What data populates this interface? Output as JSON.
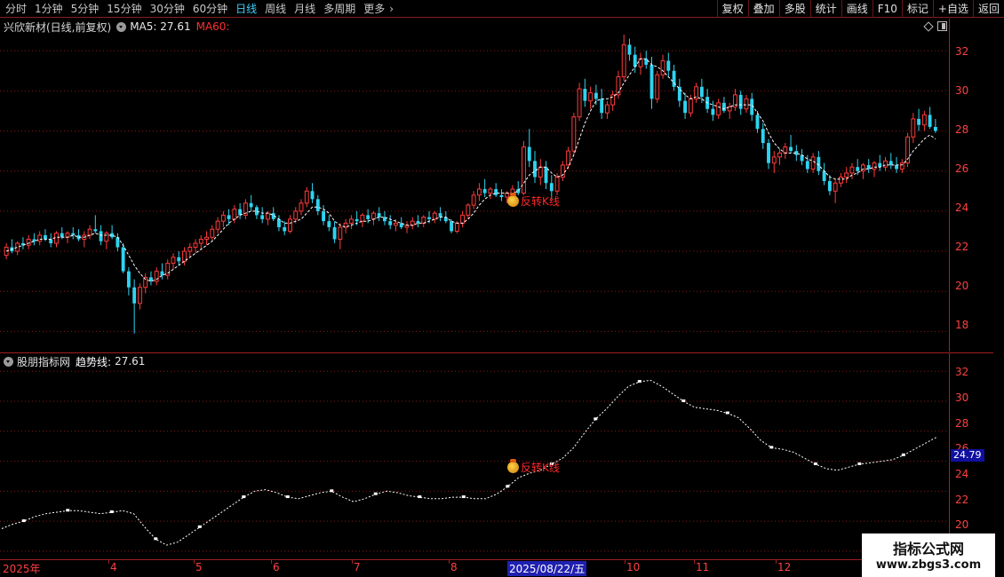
{
  "toolbar": {
    "periods": [
      "分时",
      "1分钟",
      "5分钟",
      "15分钟",
      "30分钟",
      "60分钟",
      "日线",
      "周线",
      "月线",
      "多周期",
      "更多"
    ],
    "active_period": "日线",
    "tools": [
      "复权",
      "叠加",
      "多股",
      "统计",
      "画线",
      "F10",
      "标记",
      "+自选",
      "返回"
    ]
  },
  "main_panel": {
    "stock_name": "兴欣新材(日线,前复权)",
    "ma5_label": "MA5: 27.61",
    "ma60_label": "MA60:",
    "annotation": "反转K线"
  },
  "indicator_panel": {
    "name": "股朋指标网",
    "line_label": "趋势线:",
    "line_value": "27.61",
    "current_value": "24.79",
    "annotation": "反转K线"
  },
  "date_axis": {
    "labels": [
      "2025年",
      "4",
      "5",
      "6",
      "7",
      "8",
      "10",
      "11",
      "12"
    ],
    "selected_date": "2025/08/22/五"
  },
  "watermark": {
    "title": "指标公式网",
    "url": "www.zbgs3.com"
  },
  "colors": {
    "up": "#ff3b3b",
    "down": "#2ed3f0",
    "grid": "#8a1a1a",
    "axis": "#ff4040",
    "trend": "#ffffff"
  },
  "chart_data": [
    {
      "type": "candlestick",
      "yticks": [
        18,
        20,
        22,
        24,
        26,
        28,
        30,
        32
      ],
      "ylim": [
        17.0,
        33.6
      ],
      "candles_ohlc": [
        [
          21.8,
          22.4,
          21.6,
          22.2
        ],
        [
          22.2,
          22.6,
          21.9,
          22.0
        ],
        [
          22.0,
          22.5,
          21.8,
          22.4
        ],
        [
          22.4,
          22.7,
          22.1,
          22.3
        ],
        [
          22.3,
          22.8,
          22.1,
          22.6
        ],
        [
          22.6,
          22.9,
          22.3,
          22.5
        ],
        [
          22.5,
          23.0,
          22.3,
          22.8
        ],
        [
          22.8,
          23.1,
          22.5,
          22.6
        ],
        [
          22.6,
          22.9,
          22.2,
          22.4
        ],
        [
          22.4,
          23.0,
          22.2,
          22.9
        ],
        [
          22.9,
          23.2,
          22.6,
          22.7
        ],
        [
          22.7,
          23.0,
          22.4,
          22.9
        ],
        [
          22.9,
          23.2,
          22.6,
          22.8
        ],
        [
          22.8,
          23.1,
          22.5,
          22.6
        ],
        [
          22.6,
          23.0,
          22.2,
          22.8
        ],
        [
          22.8,
          23.3,
          22.6,
          23.1
        ],
        [
          23.1,
          23.8,
          22.9,
          23.0
        ],
        [
          23.0,
          23.3,
          22.3,
          22.5
        ],
        [
          22.5,
          23.0,
          22.1,
          22.9
        ],
        [
          22.9,
          23.3,
          22.6,
          22.7
        ],
        [
          22.7,
          22.9,
          22.0,
          22.2
        ],
        [
          22.2,
          22.4,
          20.9,
          21.0
        ],
        [
          21.0,
          21.2,
          19.8,
          20.2
        ],
        [
          20.2,
          20.6,
          17.9,
          19.4
        ],
        [
          19.4,
          20.4,
          19.1,
          20.2
        ],
        [
          20.2,
          20.9,
          19.9,
          20.7
        ],
        [
          20.7,
          21.0,
          20.3,
          20.5
        ],
        [
          20.5,
          21.2,
          20.3,
          21.0
        ],
        [
          21.0,
          21.4,
          20.6,
          20.8
        ],
        [
          20.8,
          21.6,
          20.6,
          21.4
        ],
        [
          21.4,
          21.9,
          21.1,
          21.7
        ],
        [
          21.7,
          22.0,
          21.3,
          21.5
        ],
        [
          21.5,
          22.2,
          21.3,
          22.0
        ],
        [
          22.0,
          22.4,
          21.7,
          22.2
        ],
        [
          22.2,
          22.6,
          21.9,
          22.4
        ],
        [
          22.4,
          22.8,
          22.1,
          22.6
        ],
        [
          22.6,
          23.0,
          22.3,
          22.7
        ],
        [
          22.7,
          23.3,
          22.5,
          23.1
        ],
        [
          23.1,
          23.7,
          22.9,
          23.5
        ],
        [
          23.5,
          24.0,
          23.2,
          23.8
        ],
        [
          23.8,
          24.1,
          23.3,
          23.6
        ],
        [
          23.6,
          24.3,
          23.4,
          24.1
        ],
        [
          24.1,
          24.4,
          23.6,
          23.8
        ],
        [
          23.8,
          24.6,
          23.6,
          24.4
        ],
        [
          24.4,
          24.8,
          24.0,
          24.2
        ],
        [
          24.2,
          24.3,
          23.6,
          23.8
        ],
        [
          23.8,
          24.2,
          23.4,
          23.6
        ],
        [
          23.6,
          24.0,
          23.3,
          23.9
        ],
        [
          23.9,
          24.2,
          23.5,
          23.6
        ],
        [
          23.6,
          23.8,
          23.0,
          23.2
        ],
        [
          23.2,
          23.5,
          22.8,
          23.0
        ],
        [
          23.0,
          23.8,
          22.9,
          23.6
        ],
        [
          23.6,
          24.2,
          23.4,
          24.0
        ],
        [
          24.0,
          24.6,
          23.8,
          24.4
        ],
        [
          24.4,
          25.2,
          24.2,
          25.0
        ],
        [
          25.0,
          25.4,
          24.4,
          24.6
        ],
        [
          24.6,
          24.8,
          23.8,
          24.0
        ],
        [
          24.0,
          24.3,
          23.3,
          23.5
        ],
        [
          23.5,
          23.8,
          23.0,
          23.2
        ],
        [
          23.2,
          23.5,
          22.4,
          22.6
        ],
        [
          22.6,
          23.4,
          22.1,
          23.2
        ],
        [
          23.2,
          23.6,
          22.9,
          23.4
        ],
        [
          23.4,
          23.8,
          23.1,
          23.6
        ],
        [
          23.6,
          24.0,
          23.3,
          23.5
        ],
        [
          23.5,
          23.9,
          23.2,
          23.8
        ],
        [
          23.8,
          24.1,
          23.4,
          23.6
        ],
        [
          23.6,
          24.0,
          23.3,
          23.9
        ],
        [
          23.9,
          24.2,
          23.5,
          23.7
        ],
        [
          23.7,
          24.0,
          23.3,
          23.5
        ],
        [
          23.5,
          23.8,
          23.1,
          23.3
        ],
        [
          23.3,
          23.6,
          23.0,
          23.4
        ],
        [
          23.4,
          23.7,
          23.1,
          23.2
        ],
        [
          23.2,
          23.5,
          22.9,
          23.3
        ],
        [
          23.3,
          23.7,
          23.1,
          23.5
        ],
        [
          23.5,
          23.8,
          23.2,
          23.4
        ],
        [
          23.4,
          23.8,
          23.2,
          23.7
        ],
        [
          23.7,
          24.0,
          23.4,
          23.6
        ],
        [
          23.6,
          24.0,
          23.4,
          23.9
        ],
        [
          23.9,
          24.2,
          23.5,
          23.7
        ],
        [
          23.7,
          24.0,
          23.4,
          23.5
        ],
        [
          23.5,
          23.6,
          22.9,
          23.0
        ],
        [
          23.0,
          23.5,
          22.9,
          23.4
        ],
        [
          23.4,
          24.0,
          23.2,
          23.8
        ],
        [
          23.8,
          24.4,
          23.6,
          24.3
        ],
        [
          24.3,
          25.0,
          24.1,
          24.8
        ],
        [
          24.8,
          25.4,
          24.5,
          25.1
        ],
        [
          25.1,
          25.6,
          24.7,
          24.9
        ],
        [
          24.9,
          25.2,
          24.6,
          25.1
        ],
        [
          25.1,
          25.4,
          24.7,
          24.8
        ],
        [
          24.8,
          25.1,
          24.5,
          24.7
        ],
        [
          24.7,
          25.0,
          24.4,
          24.9
        ],
        [
          24.9,
          25.3,
          24.6,
          25.1
        ],
        [
          25.1,
          25.5,
          24.8,
          24.9
        ],
        [
          24.9,
          27.5,
          24.8,
          27.2
        ],
        [
          27.2,
          28.1,
          26.2,
          26.5
        ],
        [
          26.5,
          27.0,
          25.4,
          25.7
        ],
        [
          25.7,
          26.6,
          25.3,
          26.2
        ],
        [
          26.2,
          26.5,
          25.1,
          25.4
        ],
        [
          25.4,
          25.8,
          24.6,
          25.0
        ],
        [
          25.0,
          25.9,
          24.8,
          25.7
        ],
        [
          25.7,
          26.5,
          25.5,
          26.3
        ],
        [
          26.3,
          27.2,
          26.1,
          27.0
        ],
        [
          27.0,
          28.9,
          26.8,
          28.7
        ],
        [
          28.7,
          30.4,
          28.5,
          30.1
        ],
        [
          30.1,
          30.6,
          29.2,
          29.5
        ],
        [
          29.5,
          30.2,
          29.1,
          29.9
        ],
        [
          29.9,
          30.3,
          29.3,
          29.6
        ],
        [
          29.6,
          30.1,
          28.6,
          28.9
        ],
        [
          28.9,
          29.5,
          28.6,
          29.3
        ],
        [
          29.3,
          30.0,
          29.0,
          29.8
        ],
        [
          29.8,
          31.0,
          29.6,
          30.7
        ],
        [
          30.7,
          32.8,
          30.5,
          32.3
        ],
        [
          32.3,
          32.6,
          31.5,
          31.8
        ],
        [
          31.8,
          32.2,
          30.9,
          31.2
        ],
        [
          31.2,
          31.9,
          30.8,
          31.6
        ],
        [
          31.6,
          32.0,
          31.1,
          31.3
        ],
        [
          31.3,
          31.7,
          29.1,
          29.6
        ],
        [
          29.6,
          31.0,
          29.4,
          30.8
        ],
        [
          30.8,
          31.8,
          30.6,
          31.5
        ],
        [
          31.5,
          31.9,
          30.7,
          31.0
        ],
        [
          31.0,
          31.3,
          30.0,
          30.2
        ],
        [
          30.2,
          30.6,
          29.2,
          29.5
        ],
        [
          29.5,
          29.9,
          28.6,
          28.9
        ],
        [
          28.9,
          29.8,
          28.7,
          29.6
        ],
        [
          29.6,
          30.4,
          29.4,
          30.2
        ],
        [
          30.2,
          30.6,
          29.4,
          29.7
        ],
        [
          29.7,
          30.1,
          28.9,
          29.1
        ],
        [
          29.1,
          29.5,
          28.5,
          28.8
        ],
        [
          28.8,
          29.6,
          28.6,
          29.4
        ],
        [
          29.4,
          29.7,
          28.9,
          29.0
        ],
        [
          29.0,
          29.4,
          28.6,
          29.2
        ],
        [
          29.2,
          30.1,
          29.0,
          29.8
        ],
        [
          29.8,
          30.0,
          28.8,
          29.1
        ],
        [
          29.1,
          29.8,
          28.9,
          29.6
        ],
        [
          29.6,
          29.9,
          28.5,
          28.8
        ],
        [
          28.8,
          29.0,
          27.9,
          28.1
        ],
        [
          28.1,
          28.4,
          27.1,
          27.4
        ],
        [
          27.4,
          27.6,
          26.1,
          26.4
        ],
        [
          26.4,
          27.0,
          25.9,
          26.7
        ],
        [
          26.7,
          27.1,
          26.3,
          26.9
        ],
        [
          26.9,
          27.4,
          26.6,
          27.2
        ],
        [
          27.2,
          27.8,
          26.9,
          27.0
        ],
        [
          27.0,
          27.3,
          26.5,
          26.8
        ],
        [
          26.8,
          27.1,
          26.3,
          26.5
        ],
        [
          26.5,
          26.8,
          25.9,
          26.1
        ],
        [
          26.1,
          26.9,
          25.9,
          26.7
        ],
        [
          26.7,
          27.0,
          25.8,
          26.0
        ],
        [
          26.0,
          26.4,
          25.3,
          25.5
        ],
        [
          25.5,
          25.8,
          24.8,
          25.0
        ],
        [
          25.0,
          25.6,
          24.4,
          25.4
        ],
        [
          25.4,
          25.9,
          25.2,
          25.7
        ],
        [
          25.7,
          26.2,
          25.4,
          25.9
        ],
        [
          25.9,
          26.4,
          25.6,
          26.2
        ],
        [
          26.2,
          26.6,
          25.8,
          26.0
        ],
        [
          26.0,
          26.4,
          25.6,
          26.3
        ],
        [
          26.3,
          26.6,
          25.9,
          26.1
        ],
        [
          26.1,
          26.5,
          25.7,
          26.4
        ],
        [
          26.4,
          26.8,
          26.0,
          26.2
        ],
        [
          26.2,
          26.7,
          26.0,
          26.5
        ],
        [
          26.5,
          26.9,
          26.1,
          26.3
        ],
        [
          26.3,
          26.7,
          25.9,
          26.1
        ],
        [
          26.1,
          26.6,
          25.9,
          26.4
        ],
        [
          26.4,
          27.9,
          26.2,
          27.7
        ],
        [
          27.7,
          28.9,
          27.4,
          28.6
        ],
        [
          28.6,
          29.1,
          28.0,
          28.3
        ],
        [
          28.3,
          29.0,
          28.0,
          28.8
        ],
        [
          28.8,
          29.2,
          28.1,
          28.2
        ],
        [
          28.2,
          28.6,
          27.9,
          28.0
        ]
      ],
      "ma5_series": [
        22.0,
        22.1,
        22.2,
        22.3,
        22.4,
        22.5,
        22.6,
        22.6,
        22.6,
        22.7,
        22.7,
        22.7,
        22.8,
        22.7,
        22.7,
        22.8,
        22.9,
        22.8,
        22.8,
        22.8,
        22.7,
        22.3,
        21.8,
        21.3,
        20.9,
        20.6,
        20.5,
        20.6,
        20.8,
        20.9,
        21.1,
        21.3,
        21.5,
        21.7,
        21.9,
        22.1,
        22.3,
        22.5,
        22.8,
        23.1,
        23.4,
        23.6,
        23.8,
        23.9,
        24.0,
        24.0,
        23.9,
        23.9,
        23.8,
        23.6,
        23.4,
        23.4,
        23.5,
        23.6,
        23.9,
        24.2,
        24.2,
        24.1,
        23.9,
        23.5,
        23.3,
        23.2,
        23.3,
        23.4,
        23.5,
        23.5,
        23.6,
        23.7,
        23.7,
        23.6,
        23.5,
        23.4,
        23.3,
        23.3,
        23.4,
        23.4,
        23.5,
        23.6,
        23.7,
        23.7,
        23.5,
        23.4,
        23.4,
        23.6,
        23.9,
        24.3,
        24.6,
        24.8,
        24.9,
        24.9,
        24.9,
        24.9,
        25.0,
        25.4,
        25.8,
        26.0,
        26.2,
        26.2,
        25.9,
        25.7,
        25.8,
        26.2,
        26.8,
        27.6,
        28.4,
        29.0,
        29.5,
        29.6,
        29.6,
        29.7,
        29.9,
        30.4,
        30.8,
        31.2,
        31.6,
        31.6,
        31.3,
        31.2,
        31.0,
        30.7,
        30.4,
        30.1,
        29.8,
        29.6,
        29.7,
        29.6,
        29.4,
        29.3,
        29.2,
        29.1,
        29.2,
        29.3,
        29.3,
        29.3,
        29.3,
        28.9,
        28.5,
        27.9,
        27.4,
        27.1,
        26.9,
        26.9,
        26.9,
        26.8,
        26.6,
        26.5,
        26.3,
        26.0,
        25.7,
        25.6,
        25.6,
        25.6,
        25.8,
        25.9,
        26.1,
        26.1,
        26.2,
        26.2,
        26.3,
        26.3,
        26.3,
        26.3,
        26.6,
        27.0,
        27.3,
        27.6,
        27.8,
        27.6
      ]
    },
    {
      "type": "line",
      "yticks": [
        20,
        22,
        24,
        26,
        28,
        30,
        32
      ],
      "ylim": [
        19.4,
        33.2
      ],
      "trend_series": [
        21.5,
        21.8,
        22.0,
        22.3,
        22.5,
        22.6,
        22.7,
        22.7,
        22.6,
        22.5,
        22.6,
        22.7,
        22.5,
        21.6,
        20.8,
        20.4,
        20.6,
        21.1,
        21.6,
        22.1,
        22.6,
        23.1,
        23.6,
        24.0,
        24.1,
        23.9,
        23.6,
        23.5,
        23.7,
        23.9,
        24.0,
        23.6,
        23.3,
        23.5,
        23.8,
        24.0,
        23.9,
        23.7,
        23.6,
        23.5,
        23.5,
        23.6,
        23.6,
        23.5,
        23.5,
        23.8,
        24.3,
        24.9,
        25.2,
        25.4,
        25.8,
        26.2,
        26.9,
        27.9,
        28.8,
        29.5,
        30.3,
        31.0,
        31.3,
        31.4,
        31.0,
        30.5,
        30.0,
        29.6,
        29.5,
        29.4,
        29.2,
        28.9,
        28.2,
        27.4,
        26.9,
        26.8,
        26.6,
        26.2,
        25.8,
        25.5,
        25.4,
        25.6,
        25.8,
        25.9,
        26.0,
        26.1,
        26.4,
        26.8,
        27.2,
        27.6
      ]
    }
  ]
}
